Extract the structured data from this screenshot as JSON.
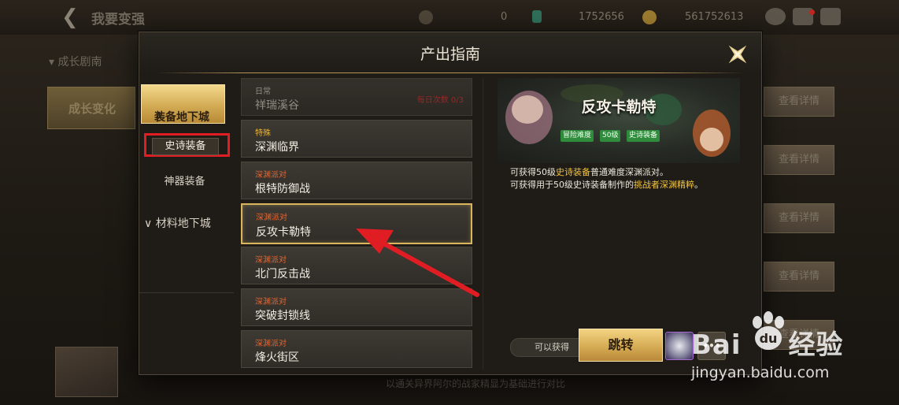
{
  "background": {
    "top_title": "我要变强",
    "currency1": "0",
    "currency2": "1752656",
    "currency3": "561752613",
    "nav_item_1": "成长剧南",
    "nav_item_2": "成长变化",
    "detail_button_label": "查看详情",
    "bottom_note": "以通关异界阿尔的战家精显为基础进行对比"
  },
  "modal": {
    "title": "产出指南",
    "category_1": "装备地下城",
    "sub_selected": "史诗装备",
    "sub_item_2": "神器装备",
    "category_2": "材料地下城"
  },
  "dungeons": [
    {
      "tag": "日常",
      "name": "祥瑞溪谷",
      "count": "每日次数 0/3",
      "tag_color": "#bdb8ae"
    },
    {
      "tag": "特殊",
      "name": "深渊临界",
      "count": "",
      "tag_color": "#e9b43a"
    },
    {
      "tag": "深渊派对",
      "name": "根特防御战",
      "count": "",
      "tag_color": "#e8662f"
    },
    {
      "tag": "深渊派对",
      "name": "反攻卡勒特",
      "count": "",
      "tag_color": "#e8662f"
    },
    {
      "tag": "深渊派对",
      "name": "北门反击战",
      "count": "",
      "tag_color": "#e8662f"
    },
    {
      "tag": "深渊派对",
      "name": "突破封锁线",
      "count": "",
      "tag_color": "#e8662f"
    },
    {
      "tag": "深渊派对",
      "name": "烽火街区",
      "count": "",
      "tag_color": "#e8662f"
    }
  ],
  "detail": {
    "title": "反攻卡勒特",
    "badges": [
      "冒险难度",
      "50级",
      "史诗装备"
    ],
    "line1_a": "可获得50级",
    "line1_hl": "史诗装备",
    "line1_b": "普通难度深渊派对。",
    "line2_a": "可获得用于50级史诗装备制作的",
    "line2_hl": "挑战者深渊精粹",
    "line2_b": "。",
    "obtain_label": "可以获得",
    "rewards": [
      "gold-coins-icon",
      "epic-orb-icon",
      "silver-ore-icon",
      "more-icon"
    ],
    "more_glyph": "•••",
    "jump_label": "跳转"
  },
  "watermark": {
    "brand_a": "Bai",
    "brand_b": "经验",
    "url": "jingyan.baidu.com"
  },
  "colors": {
    "gold": "#d6ac55",
    "highlight": "#f3c338",
    "badge_green": "#2f8c3c",
    "annotation_red": "#e11d24"
  }
}
